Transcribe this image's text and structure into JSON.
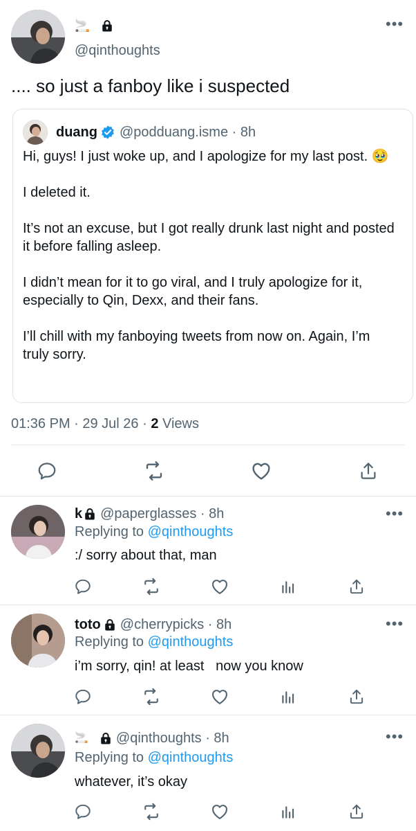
{
  "main_tweet": {
    "user_name_emoji": "🚬",
    "handle": "@qinthoughts",
    "text": ".... so just a fanboy like i suspected",
    "timestamp": "01:36 PM · 29 Jul 26 · ",
    "views_count": "2",
    "views_label": " Views"
  },
  "quoted_tweet": {
    "name": "duang",
    "handle_time": "@podduang.isme · 8h",
    "paragraphs": [
      "Hi, guys! I just woke up, and I apologize for my last post. 🥹",
      "I deleted it.",
      "It’s not an excuse, but I got really drunk last night and posted it before falling asleep.",
      "I didn’t mean for it to go viral, and I truly apologize for it, especially to Qin, Dexx, and their fans.",
      "I’ll chill with my fanboying tweets from now on. Again, I’m truly sorry."
    ]
  },
  "replies": [
    {
      "name": "k",
      "handle_time": "@paperglasses · 8h",
      "replying_prefix": "Replying to ",
      "replying_to": "@qinthoughts",
      "text": ":/ sorry about that, man"
    },
    {
      "name": "toto",
      "handle_time": "@cherrypicks · 8h",
      "replying_prefix": "Replying to ",
      "replying_to": "@qinthoughts",
      "text": "i’m sorry, qin! at least   now you know"
    },
    {
      "name": "🚬",
      "handle_time": "@qinthoughts · 8h",
      "replying_prefix": "Replying to ",
      "replying_to": "@qinthoughts",
      "text": "whatever, it’s okay"
    }
  ],
  "icons": {
    "more": "more-icon",
    "reply": "reply-icon",
    "retweet": "retweet-icon",
    "like": "heart-icon",
    "views": "views-icon",
    "share": "share-icon",
    "lock": "lock-icon",
    "verified": "verified-badge-icon"
  },
  "colors": {
    "accent": "#1d9bf0",
    "secondary_text": "#536471",
    "divider": "#e6e9eb"
  }
}
